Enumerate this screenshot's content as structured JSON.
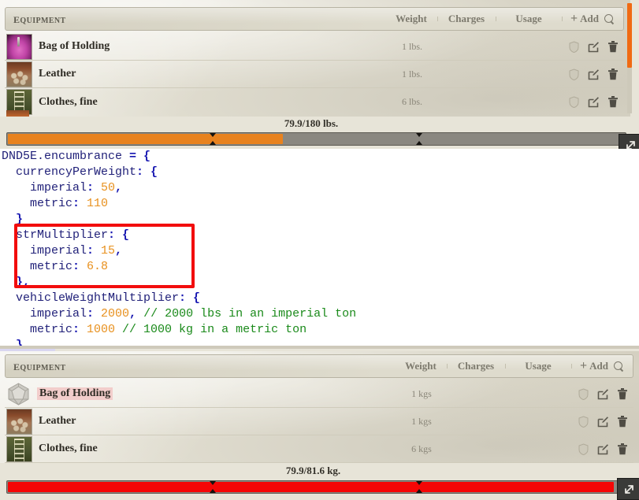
{
  "panel_top": {
    "header": {
      "title": "Equipment",
      "columns": [
        "Weight",
        "Charges",
        "Usage"
      ],
      "add_label": "Add",
      "search_icon": "search-icon",
      "plus_icon": "plus-icon"
    },
    "rows": [
      {
        "name": "Bag of Holding",
        "icon": "bag-of-holding-thumbnail",
        "weight": "1 lbs.",
        "charges": "",
        "usage": "",
        "highlighted": false
      },
      {
        "name": "Leather",
        "icon": "leather-armor-thumbnail",
        "weight": "1 lbs.",
        "charges": "",
        "usage": "",
        "highlighted": false
      },
      {
        "name": "Clothes, fine",
        "icon": "fine-clothes-thumbnail",
        "weight": "6 lbs.",
        "charges": "",
        "usage": "",
        "highlighted": false
      }
    ],
    "row_actions": [
      "shield-icon",
      "edit-icon",
      "delete-icon"
    ],
    "encumbrance": {
      "label": "79.9/180 lbs.",
      "current": 79.9,
      "max": 180,
      "percent": 44.4,
      "color": "#e8821e",
      "tick_positions_pct": [
        33.3,
        66.6
      ]
    }
  },
  "code_editor": {
    "lines": [
      {
        "indent": 0,
        "parts": [
          {
            "t": "DND5E.encumbrance",
            "c": "k"
          },
          {
            "t": " = {",
            "c": "p"
          }
        ]
      },
      {
        "indent": 1,
        "parts": [
          {
            "t": "currencyPerWeight",
            "c": "k"
          },
          {
            "t": ": {",
            "c": "p"
          }
        ]
      },
      {
        "indent": 2,
        "parts": [
          {
            "t": "imperial",
            "c": "k"
          },
          {
            "t": ": ",
            "c": "p"
          },
          {
            "t": "50",
            "c": "n"
          },
          {
            "t": ",",
            "c": "p"
          }
        ]
      },
      {
        "indent": 2,
        "parts": [
          {
            "t": "metric",
            "c": "k"
          },
          {
            "t": ": ",
            "c": "p"
          },
          {
            "t": "110",
            "c": "n"
          }
        ]
      },
      {
        "indent": 1,
        "parts": [
          {
            "t": "}",
            "c": "p"
          }
        ]
      },
      {
        "indent": 1,
        "parts": [
          {
            "t": "strMultiplier",
            "c": "k"
          },
          {
            "t": ": {",
            "c": "p"
          }
        ]
      },
      {
        "indent": 2,
        "parts": [
          {
            "t": "imperial",
            "c": "k"
          },
          {
            "t": ": ",
            "c": "p"
          },
          {
            "t": "15",
            "c": "n"
          },
          {
            "t": ",",
            "c": "p"
          }
        ]
      },
      {
        "indent": 2,
        "parts": [
          {
            "t": "metric",
            "c": "k"
          },
          {
            "t": ": ",
            "c": "p"
          },
          {
            "t": "6.8",
            "c": "n"
          }
        ]
      },
      {
        "indent": 1,
        "parts": [
          {
            "t": "},",
            "c": "p"
          }
        ]
      },
      {
        "indent": 1,
        "parts": [
          {
            "t": "vehicleWeightMultiplier",
            "c": "k"
          },
          {
            "t": ": {",
            "c": "p"
          }
        ]
      },
      {
        "indent": 2,
        "parts": [
          {
            "t": "imperial",
            "c": "k"
          },
          {
            "t": ": ",
            "c": "p"
          },
          {
            "t": "2000",
            "c": "n"
          },
          {
            "t": ", ",
            "c": "p"
          },
          {
            "t": "// 2000 lbs in an imperial ton",
            "c": "c"
          }
        ]
      },
      {
        "indent": 2,
        "parts": [
          {
            "t": "metric",
            "c": "k"
          },
          {
            "t": ": ",
            "c": "p"
          },
          {
            "t": "1000 ",
            "c": "n"
          },
          {
            "t": "// 1000 kg in a metric ton",
            "c": "c"
          }
        ]
      },
      {
        "indent": 1,
        "parts": [
          {
            "t": "}",
            "c": "p"
          }
        ]
      }
    ],
    "highlight_note": "red-annotation-box-around-strMultiplier"
  },
  "panel_bottom": {
    "header": {
      "title": "Equipment",
      "columns": [
        "Weight",
        "Charges",
        "Usage"
      ],
      "add_label": "Add",
      "search_icon": "search-icon",
      "plus_icon": "plus-icon"
    },
    "rows": [
      {
        "name": "Bag of Holding",
        "icon": "d20-placeholder-icon",
        "weight": "1 kgs",
        "charges": "",
        "usage": "",
        "highlighted": true
      },
      {
        "name": "Leather",
        "icon": "leather-armor-thumbnail",
        "weight": "1 kgs",
        "charges": "",
        "usage": "",
        "highlighted": false
      },
      {
        "name": "Clothes, fine",
        "icon": "fine-clothes-thumbnail",
        "weight": "6 kgs",
        "charges": "",
        "usage": "",
        "highlighted": false
      }
    ],
    "row_actions": [
      "shield-icon",
      "edit-icon",
      "delete-icon"
    ],
    "encumbrance": {
      "label": "79.9/81.6 kg.",
      "current": 79.9,
      "max": 81.6,
      "percent": 97.9,
      "color": "#f50606",
      "tick_positions_pct": [
        33.3,
        66.6
      ]
    }
  },
  "chrome": {
    "vertical_scrollbar": "vertical-scrollbar",
    "resize_handle_icon": "resize-handle-icon"
  }
}
